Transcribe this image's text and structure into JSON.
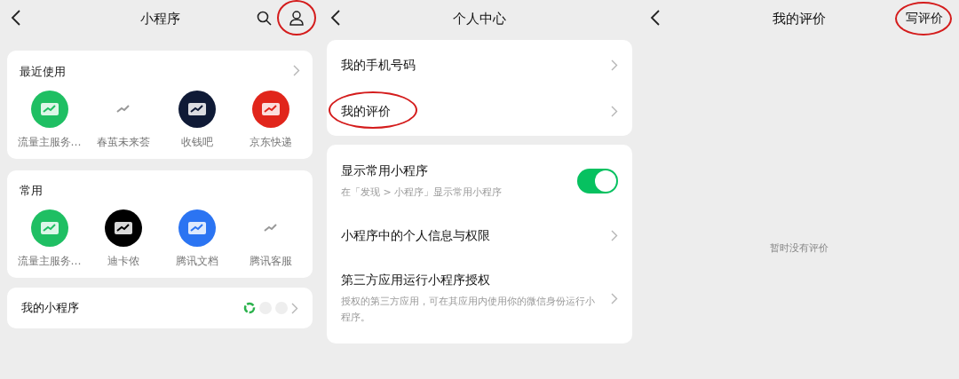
{
  "mini_programs": {
    "title": "小程序",
    "profile_button": {
      "circled": true
    },
    "sections": [
      {
        "heading": "最近使用",
        "has_more": true,
        "apps": [
          {
            "name": "流量主服务…",
            "color": "#1fbf63"
          },
          {
            "name": "春茧未来荟",
            "color": "#ffffff"
          },
          {
            "name": "收钱吧",
            "color": "#0f1a36"
          },
          {
            "name": "京东快递",
            "color": "#e1251b"
          }
        ]
      },
      {
        "heading": "常用",
        "has_more": false,
        "apps": [
          {
            "name": "流量主服务…",
            "color": "#1fbf63"
          },
          {
            "name": "迪卡侬",
            "color": "#000000"
          },
          {
            "name": "腾讯文档",
            "color": "#2b74f2"
          },
          {
            "name": "腾讯客服",
            "color": "#ffffff"
          }
        ]
      }
    ],
    "my_programs": {
      "label": "我的小程序"
    }
  },
  "personal_center": {
    "title": "个人中心",
    "groups": [
      [
        {
          "kind": "link",
          "label": "我的手机号码",
          "circled": false
        },
        {
          "kind": "link",
          "label": "我的评价",
          "circled": true
        }
      ],
      [
        {
          "kind": "toggle",
          "label": "显示常用小程序",
          "description": "在「发现 > 小程序」显示常用小程序",
          "on": true
        },
        {
          "kind": "link",
          "label": "小程序中的个人信息与权限",
          "circled": false
        },
        {
          "kind": "link",
          "label": "第三方应用运行小程序授权",
          "description": "授权的第三方应用，可在其应用内使用你的微信身份运行小程序。",
          "circled": false
        }
      ]
    ]
  },
  "my_reviews": {
    "title": "我的评价",
    "action": {
      "label": "写评价",
      "circled": true
    },
    "empty_text": "暂时没有评价"
  }
}
